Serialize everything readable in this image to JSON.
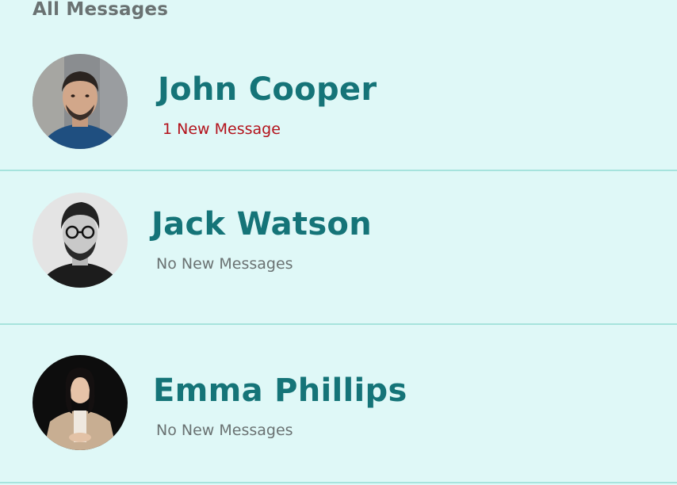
{
  "header": {
    "title": "All Messages"
  },
  "contacts": [
    {
      "name": "John Cooper",
      "status": "1 New Message"
    },
    {
      "name": "Jack Watson",
      "status": "No New Messages"
    },
    {
      "name": "Emma Phillips",
      "status": "No New Messages"
    }
  ],
  "colors": {
    "background": "#dff8f7",
    "name": "#157478",
    "new_message": "#b3121b",
    "no_message": "#6a7272",
    "divider": "#a6e3dd"
  }
}
